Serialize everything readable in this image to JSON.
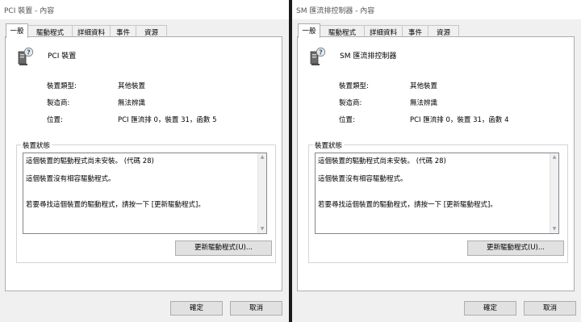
{
  "left": {
    "title": "PCI 裝置 - 內容",
    "tabs": [
      "一般",
      "驅動程式",
      "詳細資料",
      "事件",
      "資源"
    ],
    "device_name": "PCI 裝置",
    "props": [
      {
        "label": "裝置類型:",
        "value": "其他裝置"
      },
      {
        "label": "製造商:",
        "value": "無法辨識"
      },
      {
        "label": "位置:",
        "value": "PCI 匯流排 0，裝置 31，函數 5"
      }
    ],
    "status_title": "裝置狀態",
    "status_lines": [
      "這個裝置的驅動程式尚未安裝。 (代碼 28)",
      "這個裝置沒有相容驅動程式。",
      "若要尋找這個裝置的驅動程式，請按一下 [更新驅動程式]。"
    ],
    "update_button": "更新驅動程式(U)...",
    "ok_button": "確定",
    "cancel_button": "取消"
  },
  "right": {
    "title": "SM 匯流排控制器 - 內容",
    "tabs": [
      "一般",
      "驅動程式",
      "詳細資料",
      "事件",
      "資源"
    ],
    "device_name": "SM 匯流排控制器",
    "props": [
      {
        "label": "裝置類型:",
        "value": "其他裝置"
      },
      {
        "label": "製造商:",
        "value": "無法辨識"
      },
      {
        "label": "位置:",
        "value": "PCI 匯流排 0，裝置 31，函數 4"
      }
    ],
    "status_title": "裝置狀態",
    "status_lines": [
      "這個裝置的驅動程式尚未安裝。 (代碼 28)",
      "這個裝置沒有相容驅動程式。",
      "若要尋找這個裝置的驅動程式，請按一下 [更新驅動程式]。"
    ],
    "update_button": "更新驅動程式(U)...",
    "ok_button": "確定",
    "cancel_button": "取消"
  },
  "icons": {
    "device_icon": "unknown-device-icon",
    "scroll_up": "scroll-up-arrow-icon",
    "scroll_down": "scroll-down-arrow-icon"
  },
  "colors": {
    "dialog_bg": "#f0f0f0",
    "panel_bg": "#ffffff",
    "button_bg": "#e1e1e1",
    "border": "#adadad",
    "title_text": "#555555",
    "question_badge": "#e8e8e8",
    "separator": "#1a1a1a"
  }
}
